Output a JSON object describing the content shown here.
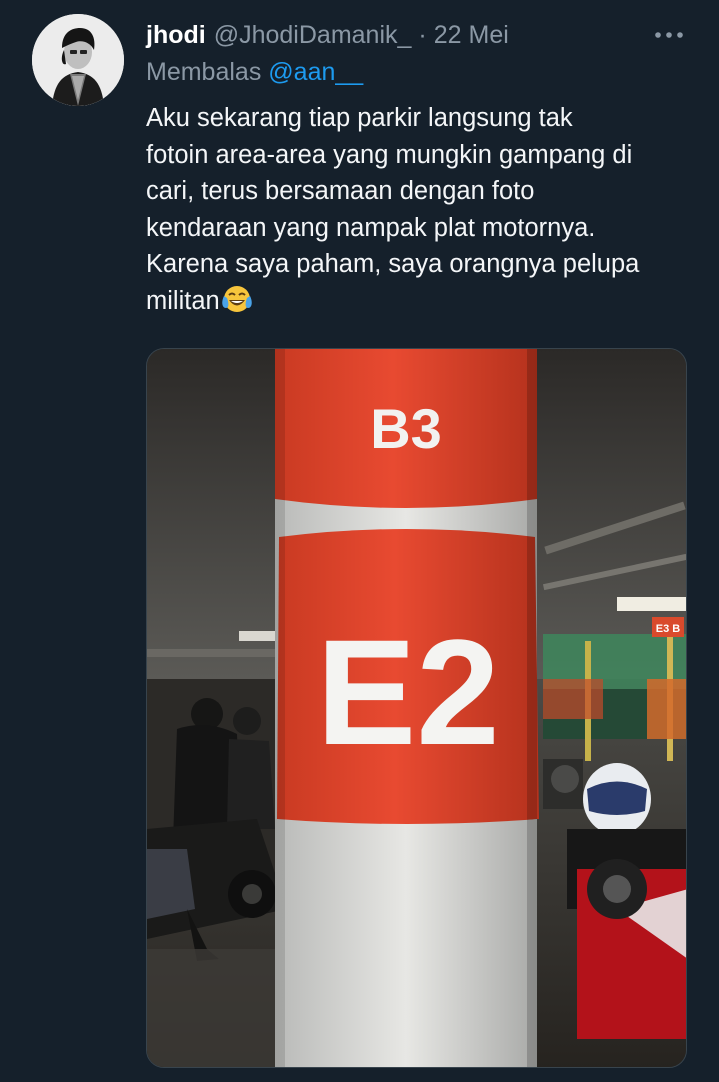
{
  "tweet": {
    "display_name": "jhodi",
    "handle": "@JhodiDamanik_",
    "separator": "·",
    "date": "22 Mei",
    "reply_prefix": "Membalas",
    "reply_mention": "@aan__",
    "text_lines": [
      "Aku sekarang tiap parkir langsung tak",
      "fotoin area-area yang mungkin gampang di",
      "cari, terus bersamaan dengan foto",
      "kendaraan yang nampak plat motornya.",
      "Karena saya paham, saya orangnya pelupa",
      "militan"
    ],
    "emoji": "face-with-tears-of-joy",
    "more_icon": "more-horizontal-icon"
  },
  "photo": {
    "pillar_top_label": "B3",
    "pillar_main_label": "E2",
    "sign_label": "E3 B"
  },
  "colors": {
    "background": "#15202b",
    "secondary_text": "#8b98a5",
    "link": "#1d9bf0",
    "pillar_red": "#e0432b"
  }
}
